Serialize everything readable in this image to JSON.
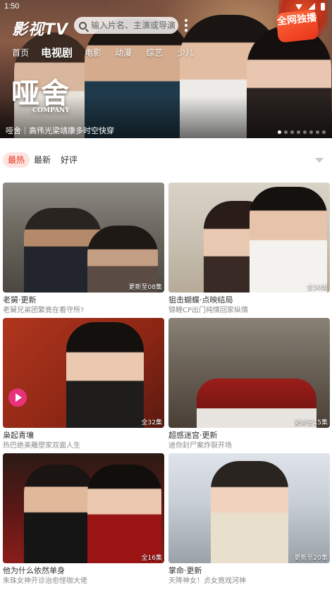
{
  "status_bar": {
    "time": "1:50"
  },
  "header": {
    "logo": "影视TV",
    "search_placeholder": "输入片名、主演或导演",
    "badge": "全网独播"
  },
  "nav": {
    "tabs": [
      {
        "label": "首页",
        "active": false
      },
      {
        "label": "电视剧",
        "active": true
      },
      {
        "label": "电影",
        "active": false
      },
      {
        "label": "动漫",
        "active": false
      },
      {
        "label": "综艺",
        "active": false
      },
      {
        "label": "少儿",
        "active": false
      }
    ]
  },
  "hero": {
    "title_art": "哑舍",
    "title_art_sub": "COMPANY",
    "caption": "哑舍｜高伟光梁靖康多时空快穿",
    "slides_total": 8,
    "slide_active": 0
  },
  "sort": {
    "options": [
      {
        "label": "最热",
        "active": true
      },
      {
        "label": "最新",
        "active": false
      },
      {
        "label": "好评",
        "active": false
      }
    ]
  },
  "cards": [
    {
      "title": "老舅·更新",
      "subtitle": "老舅兄弟团繁竟在看守所?",
      "episodes": "更新至08集",
      "has_play_icon": false
    },
    {
      "title": "狙击蝴蝶·点映结局",
      "subtitle": "锦鲤CP出门纯情回家纵情",
      "episodes": "全30集",
      "has_play_icon": false
    },
    {
      "title": "枭起青壤",
      "subtitle": "热巴绝美雕塑家双面人生",
      "episodes": "全32集",
      "has_play_icon": true
    },
    {
      "title": "超感迷宫·更新",
      "subtitle": "迪你封尸案炸裂开场",
      "episodes": "更新至15集",
      "has_play_icon": false
    },
    {
      "title": "他为什么依然单身",
      "subtitle": "朱珠女神开诊治愈怪咖大佬",
      "episodes": "全16集",
      "has_play_icon": false
    },
    {
      "title": "掌命·更新",
      "subtitle": "天降神女！贞女竟戏河神",
      "episodes": "更新至20集",
      "has_play_icon": false
    }
  ]
}
